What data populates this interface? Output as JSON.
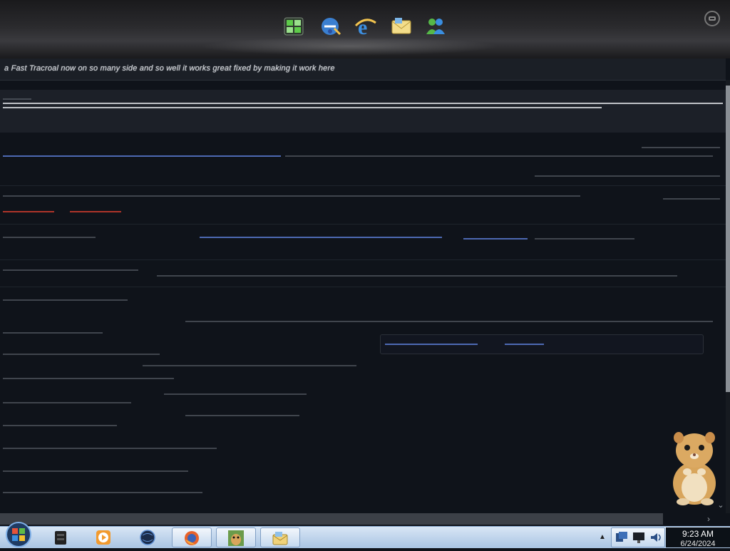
{
  "dock": {
    "icons": [
      "spreadsheet-icon",
      "internet-explorer-download-icon",
      "internet-explorer-icon",
      "mail-icon",
      "messenger-icon"
    ]
  },
  "page": {
    "first_line": "a Fast Tracroal now on so many side and so well it works great fixed by  making it work here"
  },
  "taskbar": {
    "items": [
      "start-orb-icon",
      "file-cabinet-icon",
      "media-player-icon",
      "globe-icon",
      "firefox-icon",
      "hamster-icon",
      "mail-folder-icon"
    ],
    "clock_time": "9:23 AM",
    "clock_date": "6/24/2024"
  }
}
